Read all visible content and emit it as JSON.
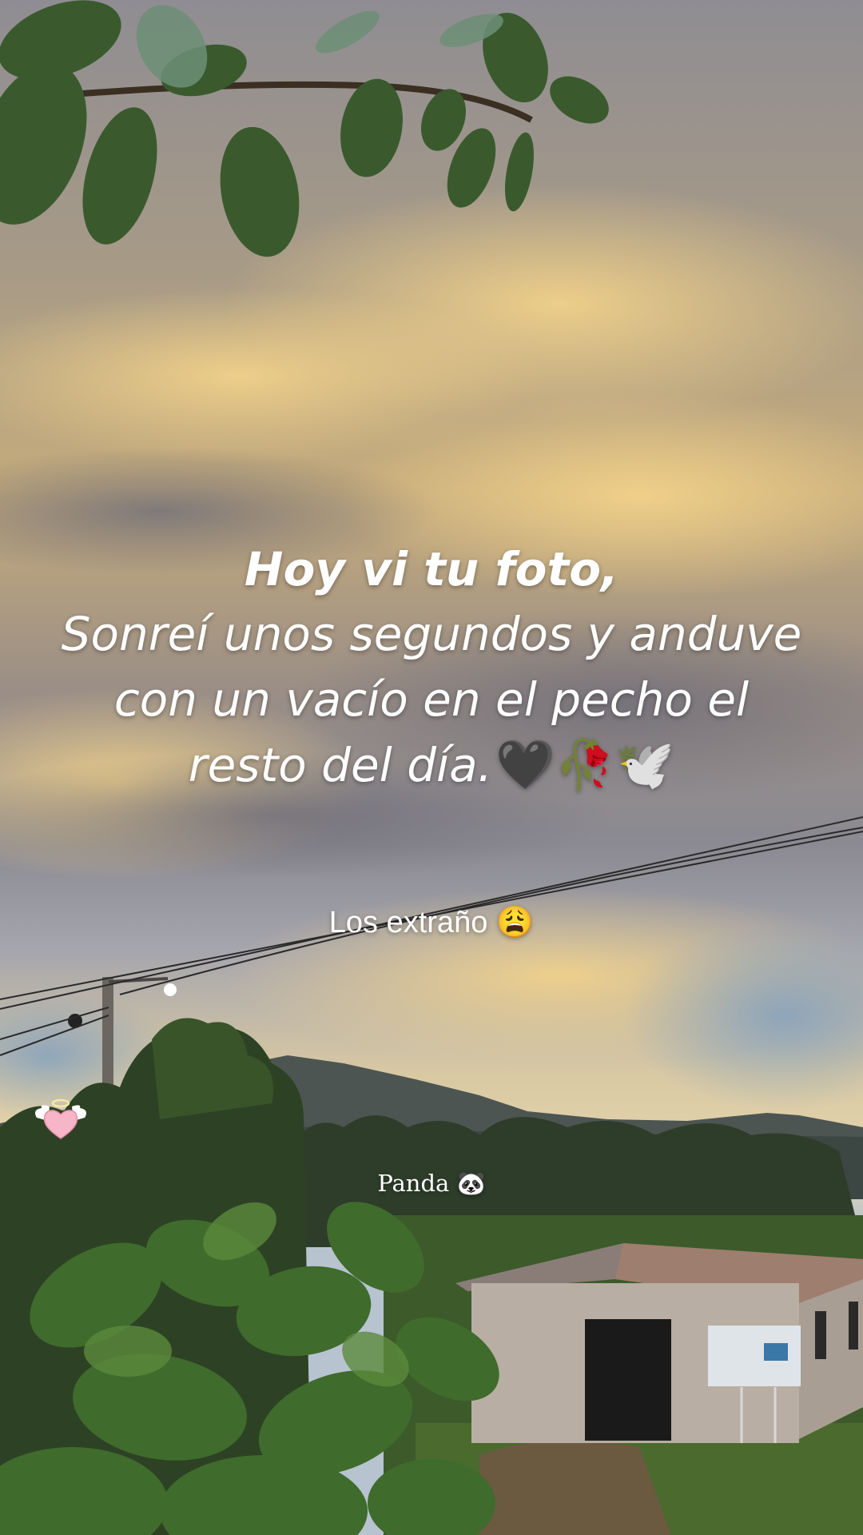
{
  "caption": {
    "headline": "Hoy vi tu foto,",
    "lines": [
      "Sonreí unos segundos y anduve",
      "con un vacío en el pecho el",
      "resto del día."
    ],
    "line_emoji": "🖤🥀🕊️"
  },
  "subtext": {
    "label": "Los extraño",
    "emoji": "😩"
  },
  "username": {
    "label": "Panda",
    "emoji": "🐼"
  },
  "sticker": {
    "icon": "angel-heart-icon"
  },
  "colors": {
    "sky_top": "#8d8c93",
    "cloud_gold": "#e9c77e",
    "foliage": "#2e4a26",
    "text": "#ffffff"
  }
}
